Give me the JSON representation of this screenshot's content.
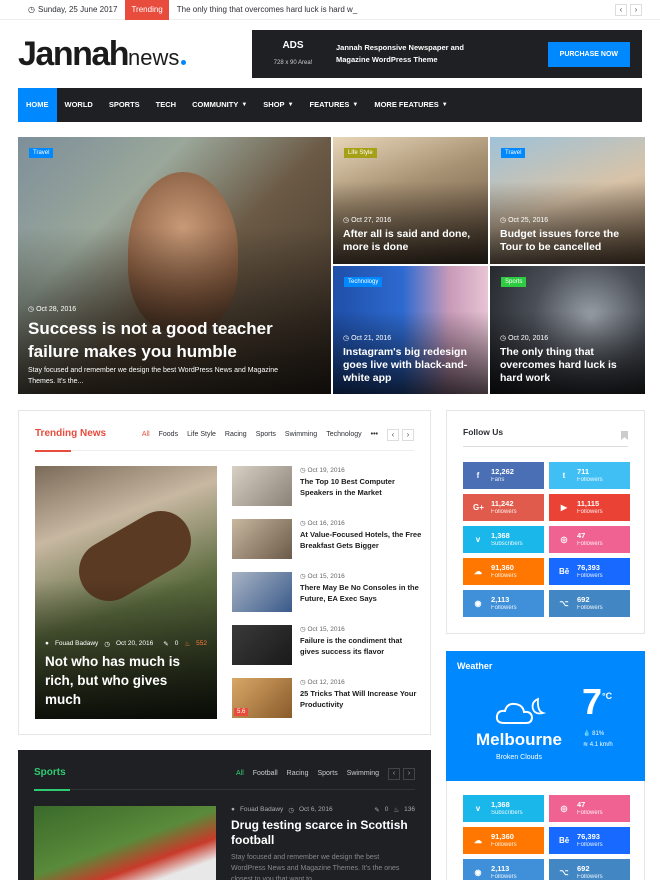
{
  "topbar": {
    "date": "Sunday, 25 June 2017",
    "trending_label": "Trending",
    "ticker": "The only thing that overcomes hard luck is hard w_"
  },
  "logo": {
    "brand": "Jannah",
    "suffix": "news"
  },
  "ad": {
    "title": "ADS",
    "size": "728 x 90 Area!",
    "text_line1": "Jannah Responsive Newspaper and",
    "text_line2": "Magazine WordPress Theme",
    "button": "PURCHASE NOW"
  },
  "nav": {
    "items": [
      {
        "label": "HOME"
      },
      {
        "label": "WORLD"
      },
      {
        "label": "SPORTS"
      },
      {
        "label": "TECH"
      },
      {
        "label": "COMMUNITY"
      },
      {
        "label": "SHOP"
      },
      {
        "label": "FEATURES"
      },
      {
        "label": "MORE FEATURES"
      }
    ]
  },
  "hero": {
    "main": {
      "tag": "Travel",
      "date": "Oct 28, 2016",
      "title_line1": "Success is not a good teacher",
      "title_line2": "failure makes you humble",
      "excerpt": "Stay focused and remember we design the best WordPress News and Magazine Themes. It's the..."
    },
    "tile1": {
      "tag": "Life Style",
      "date": "Oct 27, 2016",
      "title": "After all is said and done, more is done"
    },
    "tile2": {
      "tag": "Travel",
      "date": "Oct 25, 2016",
      "title": "Budget issues force the Tour to be cancelled"
    },
    "tile3": {
      "tag": "Technology",
      "date": "Oct 21, 2016",
      "title": "Instagram's big redesign goes live with black-and-white app"
    },
    "tile4": {
      "tag": "Sports",
      "date": "Oct 20, 2016",
      "title": "The only thing that overcomes hard luck is hard work"
    }
  },
  "trending": {
    "title": "Trending News",
    "filters": [
      "All",
      "Foods",
      "Life Style",
      "Racing",
      "Sports",
      "Swimming",
      "Technology"
    ],
    "more": "•••",
    "big": {
      "author": "Fouad Badawy",
      "date": "Oct 20, 2016",
      "comments": "0",
      "views": "552",
      "title": "Not who has much is rich, but who gives much"
    },
    "list": [
      {
        "date": "Oct 19, 2016",
        "title": "The Top 10 Best Computer Speakers in the Market"
      },
      {
        "date": "Oct 16, 2016",
        "title": "At Value-Focused Hotels, the Free Breakfast Gets Bigger"
      },
      {
        "date": "Oct 15, 2016",
        "title": "There May Be No Consoles in the Future, EA Exec Says"
      },
      {
        "date": "Oct 15, 2016",
        "title": "Failure is the condiment that gives success its flavor"
      },
      {
        "date": "Oct 12, 2016",
        "title": "25 Tricks That Will Increase Your Productivity",
        "badge": "5.6"
      }
    ]
  },
  "follow": {
    "title": "Follow Us",
    "items": [
      {
        "icon": "f",
        "count": "12,262",
        "label": "Fans",
        "color": "#4a6fb5"
      },
      {
        "icon": "t",
        "count": "711",
        "label": "Followers",
        "color": "#40bff5"
      },
      {
        "icon": "G+",
        "count": "11,242",
        "label": "Followers",
        "color": "#e05b4b"
      },
      {
        "icon": "▶",
        "count": "11,115",
        "label": "Followers",
        "color": "#ea4335"
      },
      {
        "icon": "v",
        "count": "1,368",
        "label": "Subscribers",
        "color": "#1ab7ea"
      },
      {
        "icon": "◎",
        "count": "47",
        "label": "Followers",
        "color": "#f06292"
      },
      {
        "icon": "☁",
        "count": "91,360",
        "label": "Followers",
        "color": "#ff7700"
      },
      {
        "icon": "Bē",
        "count": "76,393",
        "label": "Followers",
        "color": "#1769ff"
      },
      {
        "icon": "◉",
        "count": "2,113",
        "label": "Followers",
        "color": "#3f8fd9"
      },
      {
        "icon": "⌥",
        "count": "692",
        "label": "Followers",
        "color": "#4287c4"
      }
    ]
  },
  "weather": {
    "title": "Weather",
    "temp": "7",
    "unit": "°C",
    "city": "Melbourne",
    "condition": "Broken Clouds",
    "humidity": "81%",
    "wind": "4.1 km/h"
  },
  "follow2": {
    "items": [
      {
        "icon": "v",
        "count": "1,368",
        "label": "Subscribers",
        "color": "#1ab7ea"
      },
      {
        "icon": "◎",
        "count": "47",
        "label": "Followers",
        "color": "#f06292"
      },
      {
        "icon": "☁",
        "count": "91,360",
        "label": "Followers",
        "color": "#ff7700"
      },
      {
        "icon": "Bē",
        "count": "76,393",
        "label": "Followers",
        "color": "#1769ff"
      },
      {
        "icon": "◉",
        "count": "2,113",
        "label": "Followers",
        "color": "#3f8fd9"
      },
      {
        "icon": "⌥",
        "count": "692",
        "label": "Followers",
        "color": "#4287c4"
      }
    ]
  },
  "sports": {
    "title": "Sports",
    "filters": [
      "All",
      "Football",
      "Racing",
      "Sports",
      "Swimming"
    ],
    "author": "Fouad Badawy",
    "date": "Oct 6, 2016",
    "comments": "0",
    "views": "136",
    "headline": "Drug testing scarce in Scottish football",
    "excerpt": "Stay focused and remember we design the best WordPress News and Magazine Themes. It's the ones closest to you that want to"
  }
}
